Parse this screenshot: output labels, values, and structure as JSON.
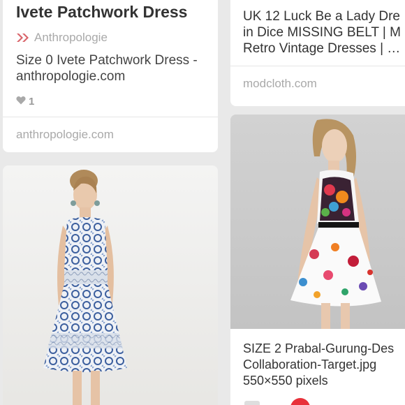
{
  "pins": {
    "left_top": {
      "title": "Ivete Patchwork Dress",
      "via": "Anthropologie",
      "description": "Size 0 Ivete Patchwork Dress - anthropologie.com",
      "likes": "1",
      "source": "anthropologie.com"
    },
    "right_top": {
      "description_lines": [
        "UK 12 Luck Be a Lady Dre",
        "in Dice MISSING BELT | M",
        "Retro Vintage Dresses | …"
      ],
      "source": "modcloth.com"
    },
    "right_bottom": {
      "description_lines": [
        "SIZE 2 Prabal-Gurung-Des",
        "Collaboration-Target.jpg",
        "550×550 pixels"
      ]
    }
  },
  "colors": {
    "background": "#e9e9e9",
    "card": "#ffffff",
    "text_primary": "#333333",
    "text_muted": "#a9a9a9",
    "accent_red": "#e8313a"
  },
  "icons": {
    "via": "double-arrow-icon",
    "likes": "heart-icon"
  }
}
